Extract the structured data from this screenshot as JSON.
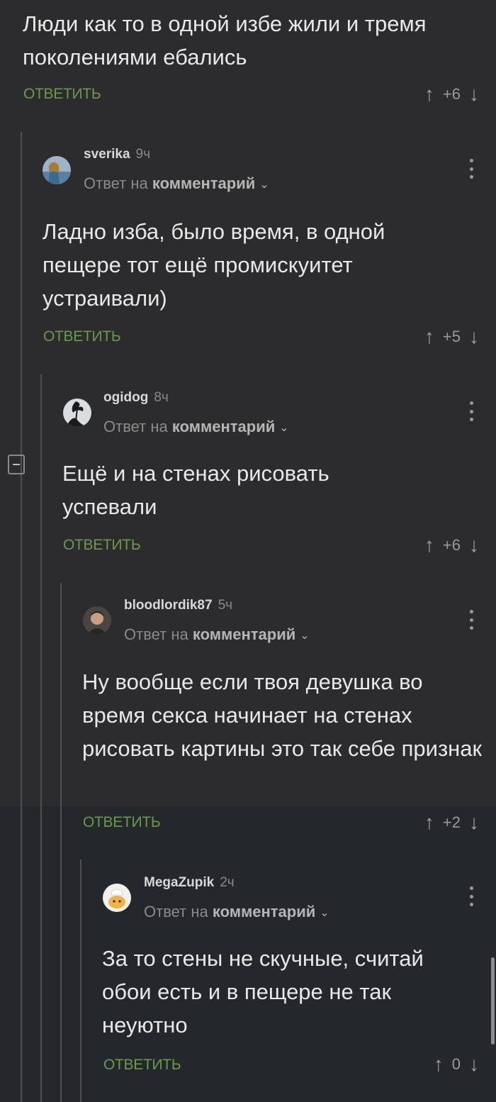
{
  "top_comment": {
    "text": "Люди как то в одной избе жили и тремя поколениями ебались",
    "reply_label": "ОТВЕТИТЬ",
    "score": "+6"
  },
  "comments": [
    {
      "username": "sverika",
      "time": "9ч",
      "reply_prefix": "Ответ на",
      "reply_target": "комментарий",
      "text": "Ладно изба, было время, в одной пещере тот ещё промискуитет устраивали)",
      "reply_label": "ОТВЕТИТЬ",
      "score": "+5"
    },
    {
      "username": "ogidog",
      "time": "8ч",
      "reply_prefix": "Ответ на",
      "reply_target": "комментарий",
      "text": "Ещё и на стенах рисовать успевали",
      "reply_label": "ОТВЕТИТЬ",
      "score": "+6"
    },
    {
      "username": "bloodlordik87",
      "time": "5ч",
      "reply_prefix": "Ответ на",
      "reply_target": "комментарий",
      "text": "Ну вообще если твоя девушка во время секса начинает на стенах рисовать картины это так себе признак",
      "reply_label": "ОТВЕТИТЬ",
      "score": "+2"
    },
    {
      "username": "MegaZupik",
      "time": "2ч",
      "reply_prefix": "Ответ на",
      "reply_target": "комментарий",
      "text": "За то стены не скучные, считай обои есть и в пещере не так неуютно",
      "reply_label": "ОТВЕТИТЬ",
      "score": "0"
    }
  ],
  "icons": {
    "upvote": "arrow-up-icon",
    "downvote": "arrow-down-icon",
    "more": "more-vertical-icon",
    "chevron": "chevron-down-icon",
    "collapse": "collapse-minus-icon"
  },
  "colors": {
    "reply_button": "#6c9a4c",
    "background": "#2c2c2e"
  }
}
